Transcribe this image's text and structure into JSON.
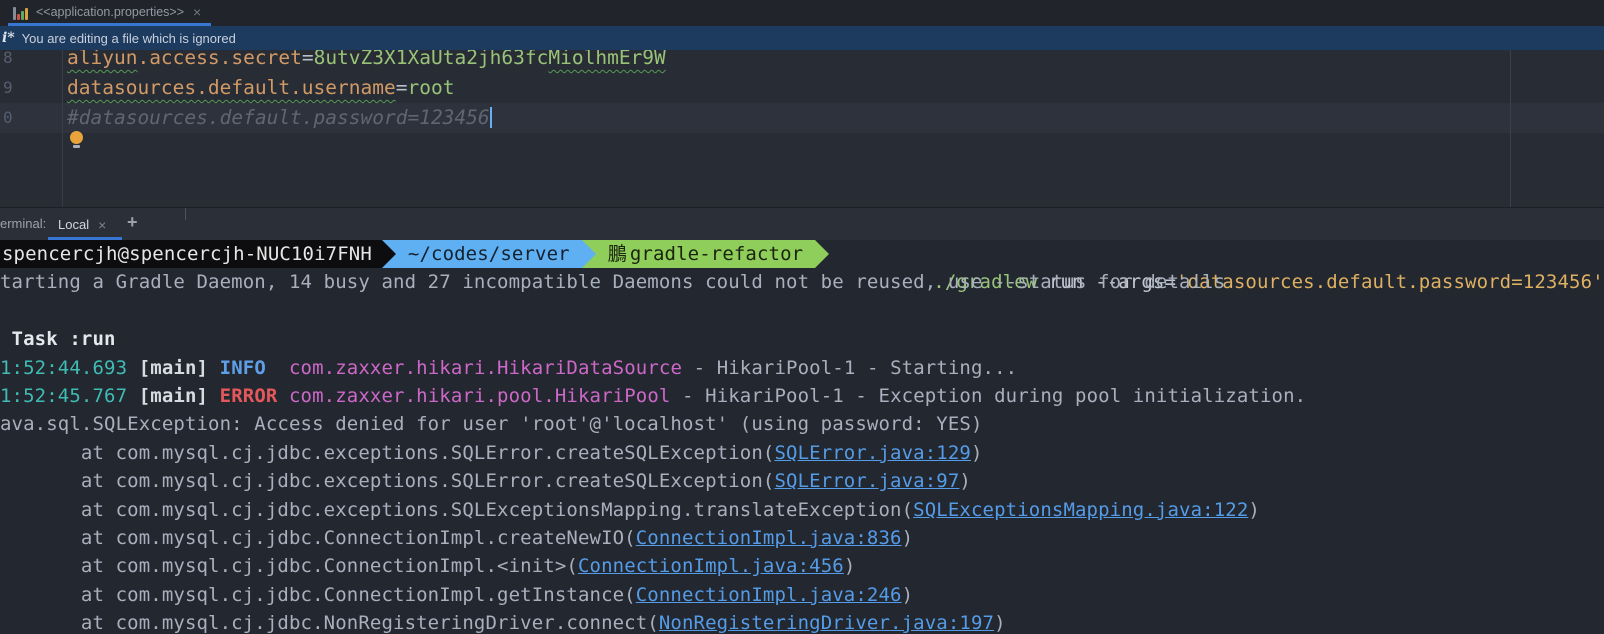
{
  "tab_bar": {
    "title": "<<application.properties>>",
    "close_label": "×"
  },
  "banner": {
    "icon_text": "i*",
    "message": "You are editing a file which is ignored"
  },
  "editor": {
    "lines": [
      {
        "num": "8",
        "caret": false,
        "segments": [
          {
            "t": "aliyun",
            "c": "keyw"
          },
          {
            "t": ".access.secret",
            "c": "key"
          },
          {
            "t": "=",
            "c": "op"
          },
          {
            "t": "8utvZ3X1XaUta2jh63fc",
            "c": "val"
          },
          {
            "t": "MiolhmEr9W",
            "c": "valw"
          }
        ]
      },
      {
        "num": "9",
        "caret": false,
        "segments": [
          {
            "t": "datasources.default.username",
            "c": "keyw"
          },
          {
            "t": "=",
            "c": "op"
          },
          {
            "t": "root",
            "c": "val"
          }
        ]
      },
      {
        "num": "0",
        "caret": true,
        "segments": [
          {
            "t": "#datasources.default.password=123456",
            "c": "com"
          }
        ]
      }
    ]
  },
  "terminal": {
    "panel_label": "erminal:",
    "tab_label": "Local",
    "tab_close": "×",
    "new_tab_label": "+",
    "prompt": {
      "host": "spencercjh@spencercjh-NUC10i7FNH",
      "cwd": "~/codes/server",
      "branch_icon": "鵬",
      "branch": "gradle-refactor",
      "cmd_exec": " ./gradlew",
      "cmd_mid": " run --args=",
      "cmd_arg": "'datasources.default.password=123456'"
    },
    "rows": [
      {
        "segments": [
          {
            "t": "tarting a Gradle Daemon, 14 busy and 27 incompatible Daemons could not be reused, use --status for details",
            "c": "plain"
          }
        ]
      },
      {
        "segments": []
      },
      {
        "segments": [
          {
            "t": " Task :run",
            "c": "task"
          }
        ]
      },
      {
        "segments": [
          {
            "t": "1:52:44.693 ",
            "c": "time"
          },
          {
            "t": "[main] ",
            "c": "mainb"
          },
          {
            "t": "INFO  ",
            "c": "info"
          },
          {
            "t": "com.zaxxer.hikari.HikariDataSource",
            "c": "logger"
          },
          {
            "t": " - HikariPool-1 - Starting...",
            "c": "plain"
          }
        ]
      },
      {
        "segments": [
          {
            "t": "1:52:45.767 ",
            "c": "time"
          },
          {
            "t": "[main] ",
            "c": "mainb"
          },
          {
            "t": "ERROR ",
            "c": "error"
          },
          {
            "t": "com.zaxxer.hikari.pool.HikariPool",
            "c": "logger"
          },
          {
            "t": " - HikariPool-1 - Exception during pool initialization.",
            "c": "plain"
          }
        ]
      },
      {
        "segments": [
          {
            "t": "ava.sql.SQLException: Access denied for user 'root'@'localhost' (using password: YES)",
            "c": "plain"
          }
        ]
      },
      {
        "segments": [
          {
            "t": "       at com.mysql.cj.jdbc.exceptions.SQLError.createSQLException(",
            "c": "plain"
          },
          {
            "t": "SQLError.java:129",
            "c": "link"
          },
          {
            "t": ")",
            "c": "plain"
          }
        ]
      },
      {
        "segments": [
          {
            "t": "       at com.mysql.cj.jdbc.exceptions.SQLError.createSQLException(",
            "c": "plain"
          },
          {
            "t": "SQLError.java:97",
            "c": "link"
          },
          {
            "t": ")",
            "c": "plain"
          }
        ]
      },
      {
        "segments": [
          {
            "t": "       at com.mysql.cj.jdbc.exceptions.SQLExceptionsMapping.translateException(",
            "c": "plain"
          },
          {
            "t": "SQLExceptionsMapping.java:122",
            "c": "link"
          },
          {
            "t": ")",
            "c": "plain"
          }
        ]
      },
      {
        "segments": [
          {
            "t": "       at com.mysql.cj.jdbc.ConnectionImpl.createNewIO(",
            "c": "plain"
          },
          {
            "t": "ConnectionImpl.java:836",
            "c": "link"
          },
          {
            "t": ")",
            "c": "plain"
          }
        ]
      },
      {
        "segments": [
          {
            "t": "       at com.mysql.cj.jdbc.ConnectionImpl.<init>(",
            "c": "plain"
          },
          {
            "t": "ConnectionImpl.java:456",
            "c": "link"
          },
          {
            "t": ")",
            "c": "plain"
          }
        ]
      },
      {
        "segments": [
          {
            "t": "       at com.mysql.cj.jdbc.ConnectionImpl.getInstance(",
            "c": "plain"
          },
          {
            "t": "ConnectionImpl.java:246",
            "c": "link"
          },
          {
            "t": ")",
            "c": "plain"
          }
        ]
      },
      {
        "segments": [
          {
            "t": "       at com.mysql.cj.jdbc.NonRegisteringDriver.connect(",
            "c": "plain"
          },
          {
            "t": "NonRegisteringDriver.java:197",
            "c": "link"
          },
          {
            "t": ")",
            "c": "plain"
          }
        ]
      }
    ]
  },
  "colors": {
    "editor_bg": "#282c34",
    "terminal_bg": "#23272f",
    "tab_underline_accent": "#3876d3",
    "banner_bg": "#1d3a5f",
    "property_key": "#d19a66",
    "property_value": "#98c379",
    "comment": "#5f6672",
    "prompt_host_bg": "#0d0d0f",
    "prompt_cwd_bg": "#5fb0f2",
    "prompt_branch_bg": "#8fce5a",
    "log_time": "#3fbcb4",
    "log_info": "#5f9fe8",
    "log_error": "#e4585c",
    "log_logger": "#cd68c8",
    "stack_link": "#559ce8",
    "command_arg_yellow": "#ddb062"
  }
}
